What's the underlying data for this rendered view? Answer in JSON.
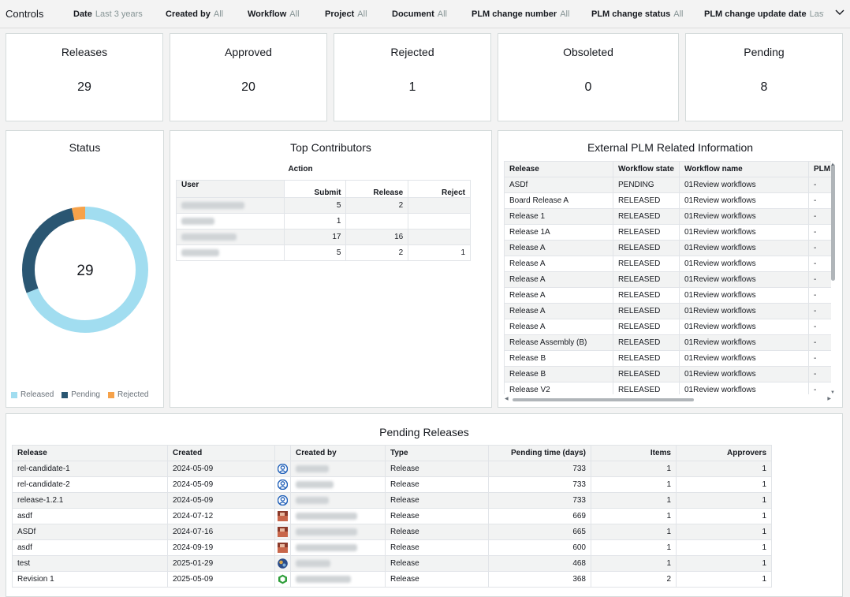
{
  "controls": {
    "title": "Controls",
    "filters": [
      {
        "label": "Date",
        "value": "Last 3 years"
      },
      {
        "label": "Created by",
        "value": "All"
      },
      {
        "label": "Workflow",
        "value": "All"
      },
      {
        "label": "Project",
        "value": "All"
      },
      {
        "label": "Document",
        "value": "All"
      },
      {
        "label": "PLM change number",
        "value": "All"
      },
      {
        "label": "PLM change status",
        "value": "All"
      },
      {
        "label": "PLM change update date",
        "value": "Last"
      }
    ]
  },
  "kpis": [
    {
      "title": "Releases",
      "value": "29"
    },
    {
      "title": "Approved",
      "value": "20"
    },
    {
      "title": "Rejected",
      "value": "1"
    },
    {
      "title": "Obsoleted",
      "value": "0"
    },
    {
      "title": "Pending",
      "value": "8"
    }
  ],
  "status": {
    "title": "Status",
    "center_value": "29",
    "released": 20,
    "pending": 8,
    "rejected": 1,
    "legend": [
      "Released",
      "Pending",
      "Rejected"
    ],
    "colors": {
      "released": "#a1ddf0",
      "pending": "#2a5672",
      "rejected": "#f6a24a"
    }
  },
  "contributors": {
    "title": "Top Contributors",
    "group_header": "Action",
    "columns": [
      "User",
      "Submit",
      "Release",
      "Reject"
    ],
    "rows": [
      {
        "submit": "5",
        "release": "2",
        "reject": ""
      },
      {
        "submit": "1",
        "release": "",
        "reject": ""
      },
      {
        "submit": "17",
        "release": "16",
        "reject": ""
      },
      {
        "submit": "5",
        "release": "2",
        "reject": "1"
      }
    ]
  },
  "external": {
    "title": "External PLM Related Information",
    "columns": [
      "Release",
      "Workflow state",
      "Workflow name",
      "PLM c"
    ],
    "rows": [
      [
        "ASDf",
        "PENDING",
        "01Review workflows",
        "-"
      ],
      [
        "Board Release A",
        "RELEASED",
        "01Review workflows",
        "-"
      ],
      [
        "Release 1",
        "RELEASED",
        "01Review workflows",
        "-"
      ],
      [
        "Release 1A",
        "RELEASED",
        "01Review workflows",
        "-"
      ],
      [
        "Release A",
        "RELEASED",
        "01Review workflows",
        "-"
      ],
      [
        "Release A",
        "RELEASED",
        "01Review workflows",
        "-"
      ],
      [
        "Release A",
        "RELEASED",
        "01Review workflows",
        "-"
      ],
      [
        "Release A",
        "RELEASED",
        "01Review workflows",
        "-"
      ],
      [
        "Release A",
        "RELEASED",
        "01Review workflows",
        "-"
      ],
      [
        "Release A",
        "RELEASED",
        "01Review workflows",
        "-"
      ],
      [
        "Release Assembly (B)",
        "RELEASED",
        "01Review workflows",
        "-"
      ],
      [
        "Release B",
        "RELEASED",
        "01Review workflows",
        "-"
      ],
      [
        "Release B",
        "RELEASED",
        "01Review workflows",
        "-"
      ],
      [
        "Release V2",
        "RELEASED",
        "01Review workflows",
        "-"
      ]
    ]
  },
  "pending": {
    "title": "Pending Releases",
    "columns": [
      "Release",
      "Created",
      "Created by",
      "Type",
      "Pending time (days)",
      "Items",
      "Approvers"
    ],
    "rows": [
      {
        "release": "rel-candidate-1",
        "created": "2024-05-09",
        "avatar": "person-blue",
        "type": "Release",
        "days": "733",
        "items": "1",
        "approvers": "1"
      },
      {
        "release": "rel-candidate-2",
        "created": "2024-05-09",
        "avatar": "person-blue",
        "type": "Release",
        "days": "733",
        "items": "1",
        "approvers": "1"
      },
      {
        "release": "release-1.2.1",
        "created": "2024-05-09",
        "avatar": "person-blue",
        "type": "Release",
        "days": "733",
        "items": "1",
        "approvers": "1"
      },
      {
        "release": "asdf",
        "created": "2024-07-12",
        "avatar": "photo-red",
        "type": "Release",
        "days": "669",
        "items": "1",
        "approvers": "1"
      },
      {
        "release": "ASDf",
        "created": "2024-07-16",
        "avatar": "photo-red",
        "type": "Release",
        "days": "665",
        "items": "1",
        "approvers": "1"
      },
      {
        "release": "asdf",
        "created": "2024-09-19",
        "avatar": "photo-red",
        "type": "Release",
        "days": "600",
        "items": "1",
        "approvers": "1"
      },
      {
        "release": "test",
        "created": "2025-01-29",
        "avatar": "photo-globe",
        "type": "Release",
        "days": "468",
        "items": "1",
        "approvers": "1"
      },
      {
        "release": "Revision 1",
        "created": "2025-05-09",
        "avatar": "hex-green",
        "type": "Release",
        "days": "368",
        "items": "2",
        "approvers": "1"
      }
    ]
  }
}
